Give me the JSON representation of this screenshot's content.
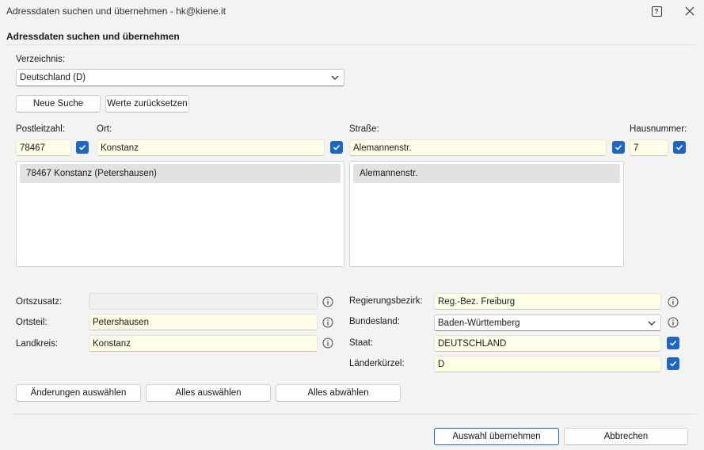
{
  "window": {
    "title": "Adressdaten suchen und übernehmen - hk@kiene.it",
    "help_glyph": "?"
  },
  "section_title": "Adressdaten suchen und übernehmen",
  "directory": {
    "label": "Verzeichnis:",
    "value": "Deutschland (D)"
  },
  "search_buttons": {
    "new_search": "Neue Suche",
    "reset": "Werte zurücksetzen"
  },
  "search_fields": {
    "plz": {
      "label": "Postleitzahl:",
      "value": "78467",
      "checked": true
    },
    "ort": {
      "label": "Ort:",
      "value": "Konstanz",
      "checked": true
    },
    "strasse": {
      "label": "Straße:",
      "value": "Alemannenstr.",
      "checked": true
    },
    "hausnummer": {
      "label": "Hausnummer:",
      "value": "7",
      "checked": true
    }
  },
  "results": {
    "places": [
      "78467 Konstanz (Petershausen)"
    ],
    "streets": [
      "Alemannenstr."
    ]
  },
  "details_left": {
    "ortszusatz": {
      "label": "Ortszusatz:",
      "value": ""
    },
    "ortsteil": {
      "label": "Ortsteil:",
      "value": "Petershausen"
    },
    "landkreis": {
      "label": "Landkreis:",
      "value": "Konstanz"
    }
  },
  "details_right": {
    "regierungsbezirk": {
      "label": "Regierungsbezirk:",
      "value": "Reg.-Bez. Freiburg"
    },
    "bundesland": {
      "label": "Bundesland:",
      "value": "Baden-Württemberg"
    },
    "staat": {
      "label": "Staat:",
      "value": "DEUTSCHLAND",
      "checked": true
    },
    "laenderkuerzel": {
      "label": "Länderkürzel:",
      "value": "D",
      "checked": true
    }
  },
  "selection_buttons": {
    "changes": "Änderungen auswählen",
    "all": "Alles auswählen",
    "none": "Alles abwählen"
  },
  "footer": {
    "apply": "Auswahl übernehmen",
    "cancel": "Abbrechen"
  },
  "colors": {
    "accent": "#1f66c1",
    "field_bg": "#fdfde8",
    "window_bg": "#f3f3f3"
  }
}
